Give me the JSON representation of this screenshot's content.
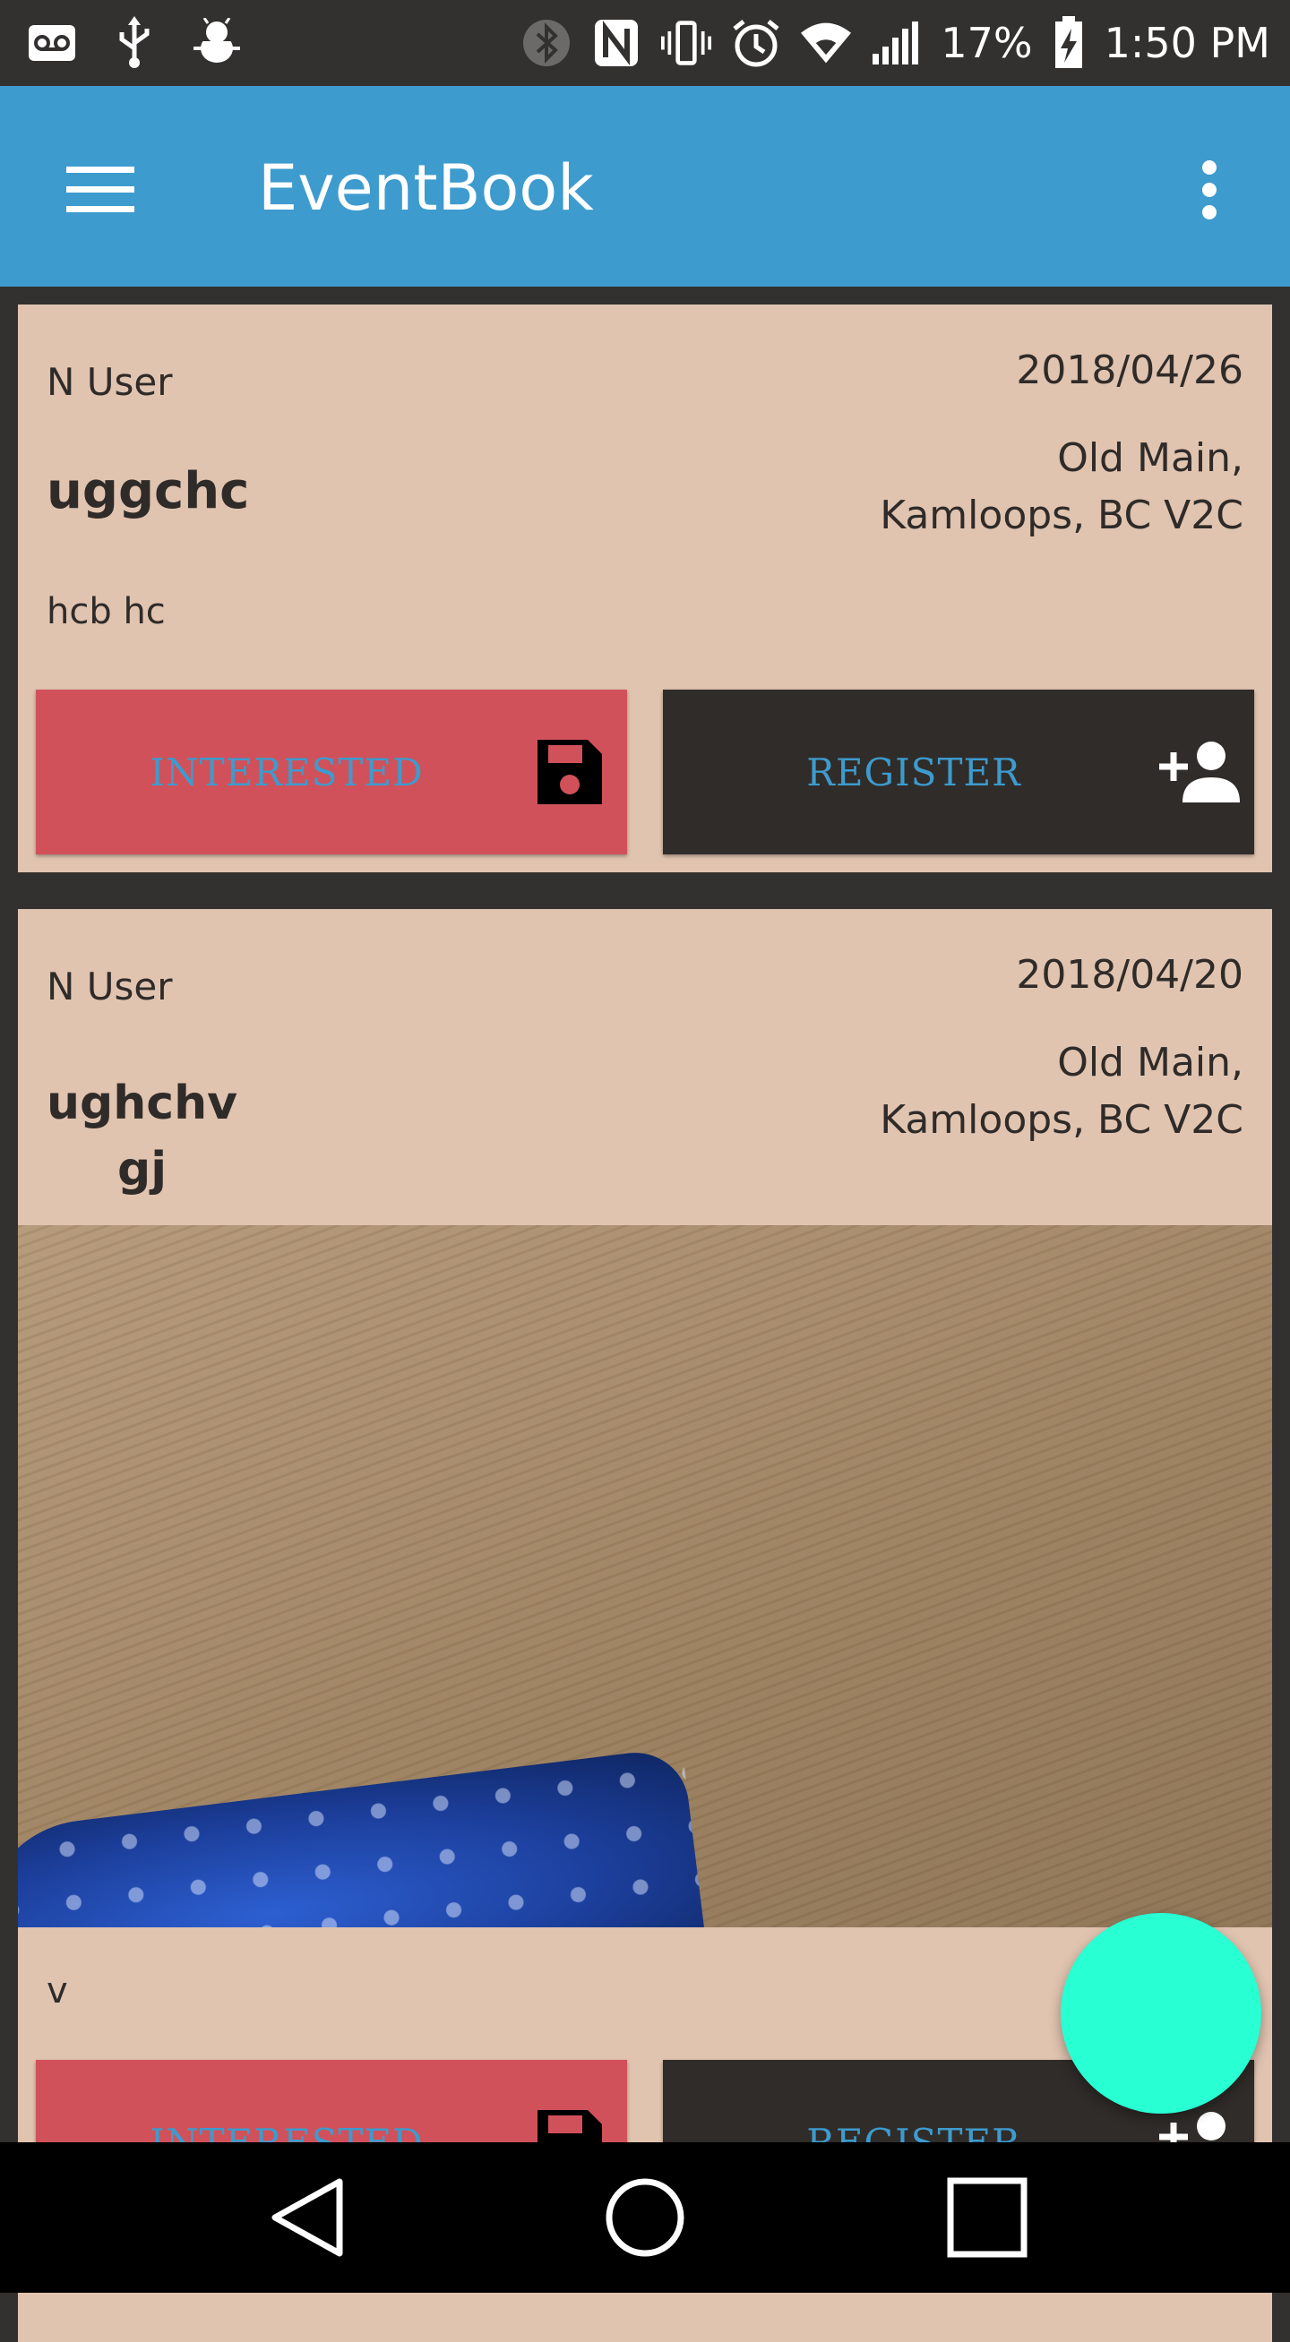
{
  "status_bar": {
    "battery": "17%",
    "time": "1:50 PM",
    "icons_left": [
      "voicemail-icon",
      "usb-icon",
      "android-debug-icon"
    ],
    "icons_right": [
      "bluetooth-icon",
      "nfc-icon",
      "vibrate-icon",
      "alarm-icon",
      "wifi-icon",
      "signal-icon",
      "battery-charging-icon"
    ]
  },
  "app_bar": {
    "title": "EventBook",
    "menu_icon": "hamburger-menu-icon",
    "overflow_icon": "more-vert-icon"
  },
  "events": [
    {
      "author": "N User",
      "date": "2018/04/26",
      "title": "uggchc",
      "location_line1": "Old Main,",
      "location_line2": "Kamloops, BC V2C",
      "description": "hcb hc",
      "interested_label": "INTERESTED",
      "register_label": "REGISTER"
    },
    {
      "author": "N User",
      "date": "2018/04/20",
      "title_line1": "ughchv",
      "title_line2": "gj",
      "location_line1": "Old Main,",
      "location_line2": "Kamloops, BC V2C",
      "description": "v",
      "interested_label": "INTERESTED",
      "register_label": "REGISTER",
      "has_photo": true
    }
  ],
  "colors": {
    "app_bar": "#3d9bce",
    "card": "#e0c4b0",
    "interested_button": "#d1515a",
    "register_button": "#302c29",
    "button_text": "#3d9bce",
    "fab": "#28ffd3"
  },
  "nav_bar": [
    "back-icon",
    "home-icon",
    "recents-icon"
  ]
}
